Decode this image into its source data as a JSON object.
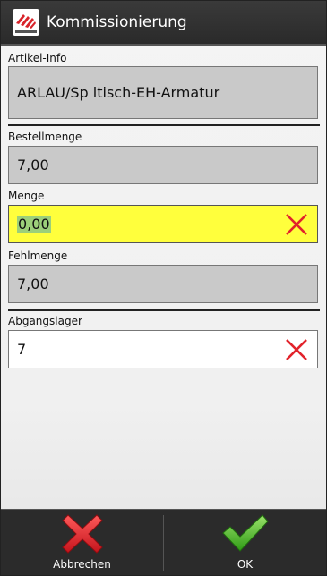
{
  "app": {
    "title": "Kommissionierung"
  },
  "fields": {
    "artikel_info": {
      "label": "Artikel-Info",
      "value": "ARLAU/Sp ltisch-EH-Armatur"
    },
    "bestellmenge": {
      "label": "Bestellmenge",
      "value": "7,00"
    },
    "menge": {
      "label": "Menge",
      "value": "0,00"
    },
    "fehlmenge": {
      "label": "Fehlmenge",
      "value": "7,00"
    },
    "abgangslager": {
      "label": "Abgangslager",
      "value": "7"
    }
  },
  "actions": {
    "cancel_label": "Abbrechen",
    "ok_label": "OK"
  },
  "colors": {
    "highlight": "#ffff3c",
    "cancel": "#e2222b",
    "ok": "#48b928"
  }
}
